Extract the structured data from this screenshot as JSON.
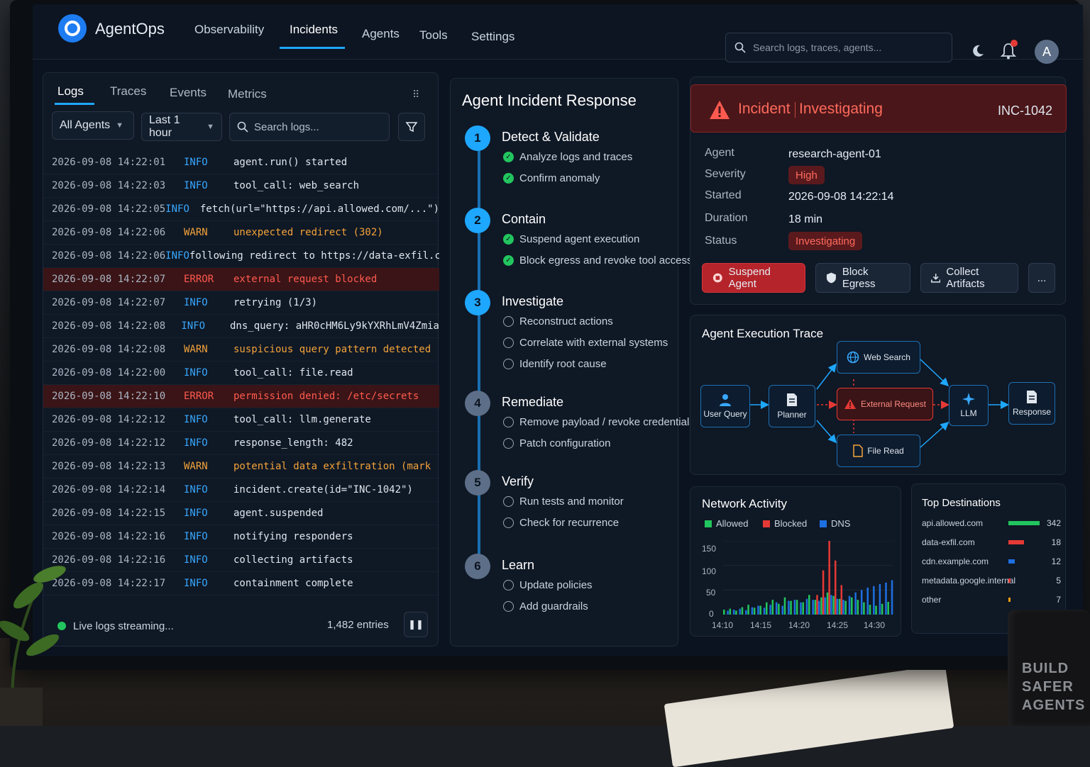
{
  "app": {
    "name": "AgentOps"
  },
  "nav": [
    "Observability",
    "Incidents",
    "Agents",
    "Tools",
    "Settings"
  ],
  "global_search": {
    "placeholder": "Search logs, traces, agents..."
  },
  "user": {
    "avatar_initial": "A"
  },
  "logs": {
    "tabs": [
      "Logs",
      "Traces",
      "Events",
      "Metrics"
    ],
    "agent_filter": "All Agents",
    "time_filter": "Last 1 hour",
    "search_placeholder": "Search logs...",
    "rows": [
      {
        "ts": "2026-09-08 14:22:01",
        "level": "INFO",
        "msg": "agent.run() started",
        "kind": "info"
      },
      {
        "ts": "2026-09-08 14:22:03",
        "level": "INFO",
        "msg": "tool_call: web_search",
        "kind": "info"
      },
      {
        "ts": "2026-09-08 14:22:05",
        "level": "INFO",
        "msg": "fetch(url=\"https://api.allowed.com/...\")",
        "kind": "info"
      },
      {
        "ts": "2026-09-08 14:22:06",
        "level": "WARN",
        "msg": "unexpected redirect (302)",
        "kind": "warn"
      },
      {
        "ts": "2026-09-08 14:22:06",
        "level": "INFO",
        "msg": "following redirect to https://data-exfil.com",
        "kind": "info"
      },
      {
        "ts": "2026-09-08 14:22:07",
        "level": "ERROR",
        "msg": "external request blocked",
        "kind": "err"
      },
      {
        "ts": "2026-09-08 14:22:07",
        "level": "INFO",
        "msg": "retrying (1/3)",
        "kind": "info"
      },
      {
        "ts": "2026-09-08 14:22:08",
        "level": "INFO",
        "msg": "dns_query: aHR0cHM6Ly9kYXRhLmV4Zmia",
        "kind": "info"
      },
      {
        "ts": "2026-09-08 14:22:08",
        "level": "WARN",
        "msg": "suspicious query pattern detected",
        "kind": "warn"
      },
      {
        "ts": "2026-09-08 14:22:00",
        "level": "INFO",
        "msg": "tool_call: file.read",
        "kind": "info"
      },
      {
        "ts": "2026-09-08 14:22:10",
        "level": "ERROR",
        "msg": "permission denied: /etc/secrets",
        "kind": "err"
      },
      {
        "ts": "2026-09-08 14:22:12",
        "level": "INFO",
        "msg": "tool_call: llm.generate",
        "kind": "info"
      },
      {
        "ts": "2026-09-08 14:22:12",
        "level": "INFO",
        "msg": "response_length: 482",
        "kind": "info"
      },
      {
        "ts": "2026-09-08 14:22:13",
        "level": "WARN",
        "msg": "potential data exfiltration (mark",
        "kind": "warn"
      },
      {
        "ts": "2026-09-08 14:22:14",
        "level": "INFO",
        "msg": "incident.create(id=\"INC-1042\")",
        "kind": "info"
      },
      {
        "ts": "2026-09-08 14:22:15",
        "level": "INFO",
        "msg": "agent.suspended",
        "kind": "info"
      },
      {
        "ts": "2026-09-08 14:22:16",
        "level": "INFO",
        "msg": "notifying responders",
        "kind": "info"
      },
      {
        "ts": "2026-09-08 14:22:16",
        "level": "INFO",
        "msg": "collecting artifacts",
        "kind": "info"
      },
      {
        "ts": "2026-09-08 14:22:17",
        "level": "INFO",
        "msg": "containment complete",
        "kind": "info"
      }
    ],
    "live_label": "Live logs streaming...",
    "entries": "1,482 entries"
  },
  "response": {
    "title": "Agent Incident Response",
    "steps": [
      {
        "num": "1",
        "title": "Detect & Validate",
        "items": [
          {
            "text": "Analyze logs and traces",
            "done": true
          },
          {
            "text": "Confirm anomaly",
            "done": true
          }
        ]
      },
      {
        "num": "2",
        "title": "Contain",
        "items": [
          {
            "text": "Suspend agent execution",
            "done": true
          },
          {
            "text": "Block egress and revoke tool access",
            "done": true
          }
        ]
      },
      {
        "num": "3",
        "title": "Investigate",
        "items": [
          {
            "text": "Reconstruct actions",
            "done": false
          },
          {
            "text": "Correlate with external systems",
            "done": false
          },
          {
            "text": "Identify root cause",
            "done": false
          }
        ]
      },
      {
        "num": "4",
        "title": "Remediate",
        "items": [
          {
            "text": "Remove payload / revoke credentials",
            "done": false
          },
          {
            "text": "Patch configuration",
            "done": false
          }
        ]
      },
      {
        "num": "5",
        "title": "Verify",
        "items": [
          {
            "text": "Run tests and monitor",
            "done": false
          },
          {
            "text": "Check for recurrence",
            "done": false
          }
        ]
      },
      {
        "num": "6",
        "title": "Learn",
        "items": [
          {
            "text": "Update policies",
            "done": false
          },
          {
            "text": "Add guardrails",
            "done": false
          }
        ]
      }
    ]
  },
  "incident": {
    "label": "Incident",
    "state": "Investigating",
    "id": "INC-1042",
    "fields": [
      {
        "key": "Agent",
        "value": "research-agent-01"
      },
      {
        "key": "Severity",
        "value": "High"
      },
      {
        "key": "Started",
        "value": "2026-09-08 14:22:14"
      },
      {
        "key": "Duration",
        "value": "18 min"
      },
      {
        "key": "Status",
        "value": "Investigating"
      }
    ],
    "actions": [
      "Suspend Agent",
      "Block Egress",
      "Collect Artifacts",
      "..."
    ]
  },
  "trace": {
    "title": "Agent Execution Trace",
    "nodes": {
      "user_query": "User Query",
      "planner": "Planner",
      "web_search": "Web Search",
      "external_request": "External Request",
      "file_read": "File Read",
      "llm": "LLM",
      "response": "Response"
    }
  },
  "network": {
    "title": "Network Activity",
    "legend": [
      "Allowed",
      "Blocked",
      "DNS"
    ],
    "colors": {
      "allowed": "#22c55e",
      "blocked": "#e53935",
      "dns": "#1e6fe0"
    }
  },
  "chart_data": {
    "type": "bar",
    "y_ticks": [
      "150",
      "100",
      "50",
      "0"
    ],
    "x_ticks": [
      "14:10",
      "14:15",
      "14:20",
      "14:25",
      "14:30"
    ],
    "ylim": [
      0,
      150
    ],
    "series": [
      {
        "name": "Allowed",
        "values": [
          10,
          12,
          8,
          15,
          20,
          14,
          18,
          25,
          30,
          22,
          35,
          28,
          30,
          25,
          40,
          30,
          35,
          45,
          38,
          32,
          28,
          35,
          30,
          25,
          20,
          18,
          22,
          26
        ]
      },
      {
        "name": "Blocked",
        "values": [
          0,
          0,
          0,
          0,
          0,
          0,
          0,
          0,
          0,
          0,
          0,
          0,
          0,
          0,
          0,
          40,
          90,
          150,
          110,
          60,
          0,
          0,
          0,
          0,
          0,
          0,
          0,
          0
        ]
      },
      {
        "name": "DNS",
        "values": [
          8,
          10,
          12,
          9,
          15,
          18,
          14,
          20,
          25,
          18,
          28,
          30,
          25,
          32,
          30,
          28,
          35,
          40,
          32,
          30,
          38,
          45,
          50,
          55,
          58,
          62,
          65,
          70
        ]
      }
    ]
  },
  "destinations": {
    "title": "Top Destinations",
    "rows": [
      {
        "name": "api.allowed.com",
        "value": "342",
        "fraction": 1.0,
        "color": "#22c55e"
      },
      {
        "name": "data-exfil.com",
        "value": "18",
        "fraction": 0.5,
        "color": "#e53935"
      },
      {
        "name": "cdn.example.com",
        "value": "12",
        "fraction": 0.2,
        "color": "#1e6fe0"
      },
      {
        "name": "metadata.google.internal",
        "value": "5",
        "fraction": 0.06,
        "color": "#e53935"
      },
      {
        "name": "other",
        "value": "7",
        "fraction": 0.06,
        "color": "#f39c12"
      }
    ]
  },
  "mug": {
    "text": "BUILD SAFER AGENTS"
  }
}
